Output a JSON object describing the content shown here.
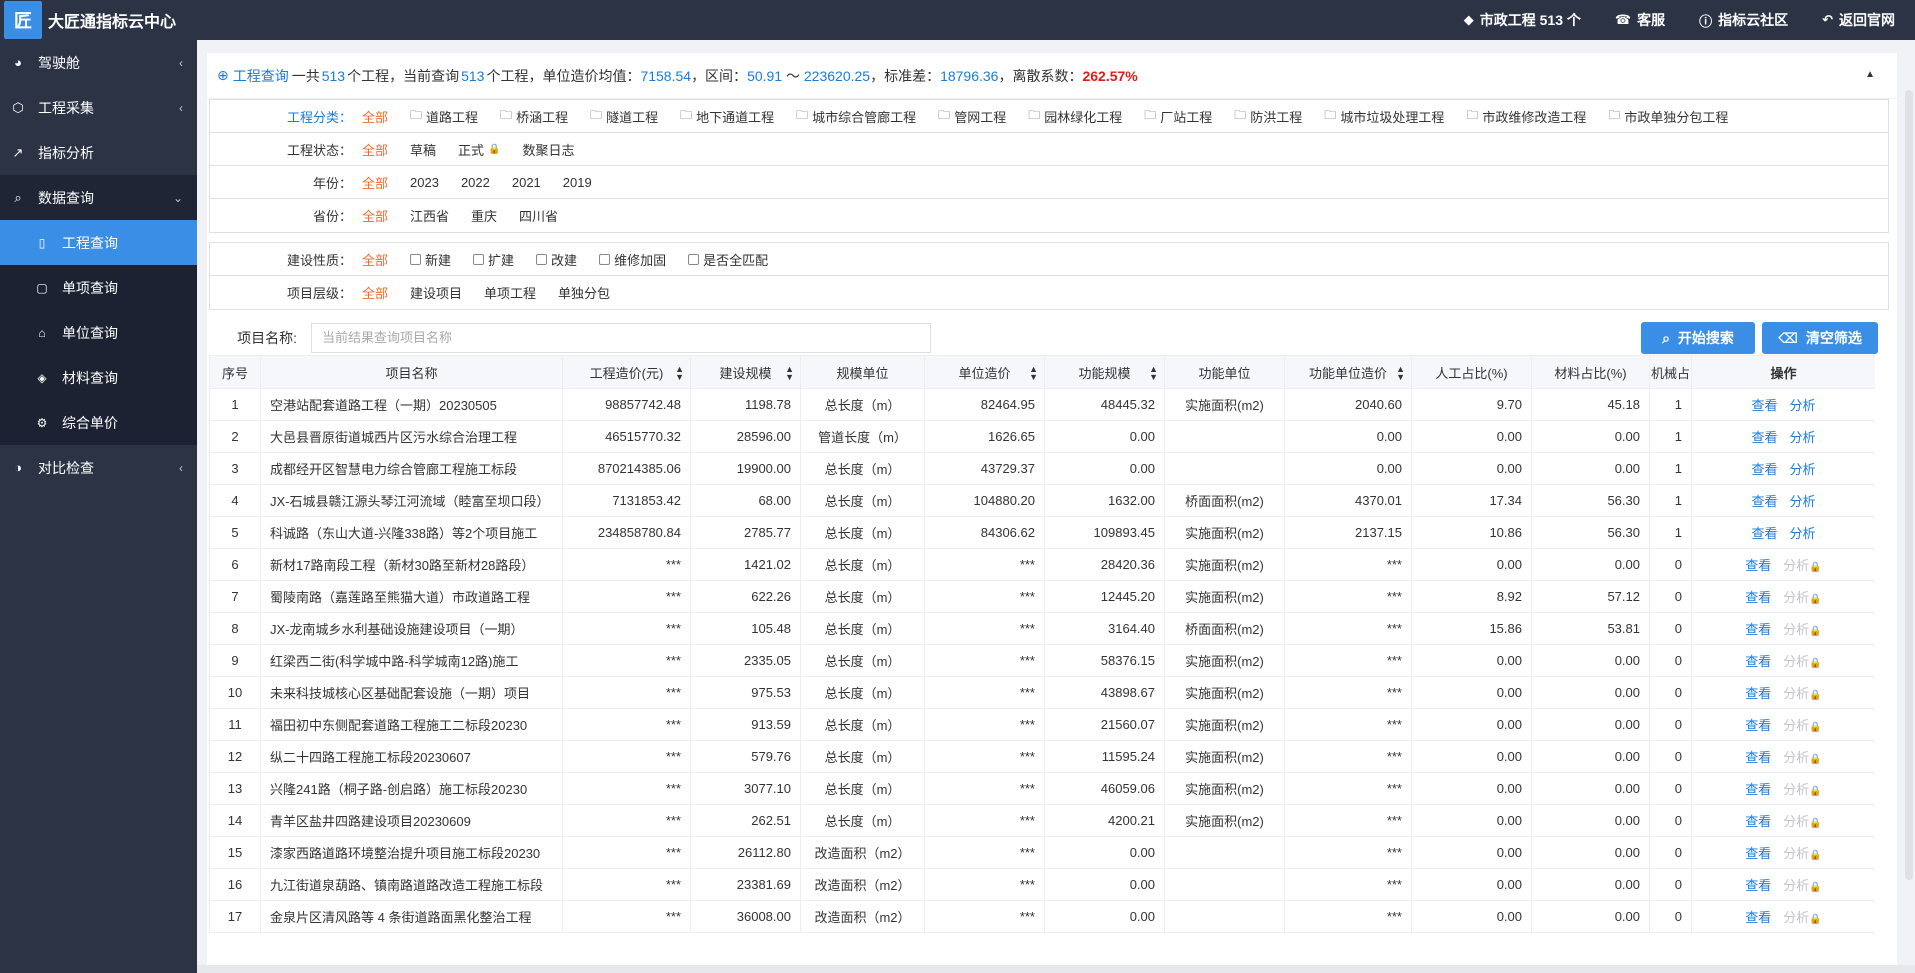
{
  "app": {
    "title": "大匠通指标云中心",
    "logo_text": "匠"
  },
  "topnav": {
    "project_count": "市政工程 513 个",
    "service": "客服",
    "community": "指标云社区",
    "back": "返回官网"
  },
  "sidebar": {
    "items": [
      {
        "label": "驾驶舱",
        "icon": "dashboard-icon"
      },
      {
        "label": "工程采集",
        "icon": "cube-icon"
      },
      {
        "label": "指标分析",
        "icon": "chart-line-icon"
      },
      {
        "label": "数据查询",
        "icon": "search-icon"
      },
      {
        "label": "对比检查",
        "icon": "compare-icon"
      }
    ],
    "subitems": [
      {
        "label": "工程查询"
      },
      {
        "label": "单项查询"
      },
      {
        "label": "单位查询"
      },
      {
        "label": "材料查询"
      },
      {
        "label": "综合单价"
      }
    ]
  },
  "summary": {
    "prefix": "工程查询",
    "t1": "一共",
    "total": "513",
    "t2": "个工程，当前查询",
    "current": "513",
    "t3": "个工程，单位造价均值：",
    "mean": "7158.54",
    "t4": "，区间：",
    "range_low": "50.91",
    "tilde": " ～ ",
    "range_high": "223620.25",
    "t5": "，标准差：",
    "std": "18796.36",
    "t6": "，离散系数：",
    "cv": "262.57%"
  },
  "filters": {
    "category": {
      "label": "工程分类：",
      "options": [
        "全部",
        "道路工程",
        "桥涵工程",
        "隧道工程",
        "地下通道工程",
        "城市综合管廊工程",
        "管网工程",
        "园林绿化工程",
        "厂站工程",
        "防洪工程",
        "城市垃圾处理工程",
        "市政维修改造工程",
        "市政单独分包工程"
      ]
    },
    "status": {
      "label": "工程状态：",
      "options": [
        "全部",
        "草稿",
        "正式",
        "数聚日志"
      ]
    },
    "year": {
      "label": "年份：",
      "options": [
        "全部",
        "2023",
        "2022",
        "2021",
        "2019"
      ]
    },
    "province": {
      "label": "省份：",
      "options": [
        "全部",
        "江西省",
        "重庆",
        "四川省"
      ]
    },
    "nature": {
      "label": "建设性质：",
      "options": [
        "全部",
        "新建",
        "扩建",
        "改建",
        "维修加固",
        "是否全匹配"
      ]
    },
    "level": {
      "label": "项目层级：",
      "options": [
        "全部",
        "建设项目",
        "单项工程",
        "单独分包"
      ]
    }
  },
  "search": {
    "label": "项目名称:",
    "placeholder": "当前结果查询项目名称",
    "search_btn": "开始搜索",
    "clear_btn": "清空筛选"
  },
  "table": {
    "headers": [
      "序号",
      "项目名称",
      "工程造价(元)",
      "建设规模",
      "规模单位",
      "单位造价",
      "功能规模",
      "功能单位",
      "功能单位造价",
      "人工占比(%)",
      "材料占比(%)",
      "机械占",
      "操作"
    ],
    "view": "查看",
    "analyze": "分析",
    "rows": [
      [
        "1",
        "空港站配套道路工程（一期）20230505",
        "98857742.48",
        "1198.78",
        "总长度（m）",
        "82464.95",
        "48445.32",
        "实施面积(m2)",
        "2040.60",
        "9.70",
        "45.18",
        "1"
      ],
      [
        "2",
        "大邑县晋原街道城西片区污水综合治理工程",
        "46515770.32",
        "28596.00",
        "管道长度（m）",
        "1626.65",
        "0.00",
        "",
        "0.00",
        "0.00",
        "0.00",
        "1"
      ],
      [
        "3",
        "成都经开区智慧电力综合管廊工程施工标段",
        "870214385.06",
        "19900.00",
        "总长度（m）",
        "43729.37",
        "0.00",
        "",
        "0.00",
        "0.00",
        "0.00",
        "1"
      ],
      [
        "4",
        "JX-石城县赣江源头琴江河流域（睦富至坝口段）",
        "7131853.42",
        "68.00",
        "总长度（m）",
        "104880.20",
        "1632.00",
        "桥面面积(m2)",
        "4370.01",
        "17.34",
        "56.30",
        "1"
      ],
      [
        "5",
        "科诚路（东山大道-兴隆338路）等2个项目施工",
        "234858780.84",
        "2785.77",
        "总长度（m）",
        "84306.62",
        "109893.45",
        "实施面积(m2)",
        "2137.15",
        "10.86",
        "56.30",
        "1"
      ],
      [
        "6",
        "新材17路南段工程（新材30路至新材28路段）",
        "***",
        "1421.02",
        "总长度（m）",
        "***",
        "28420.36",
        "实施面积(m2)",
        "***",
        "0.00",
        "0.00",
        "0"
      ],
      [
        "7",
        "蜀陵南路（嘉莲路至熊猫大道）市政道路工程",
        "***",
        "622.26",
        "总长度（m）",
        "***",
        "12445.20",
        "实施面积(m2)",
        "***",
        "8.92",
        "57.12",
        "0"
      ],
      [
        "8",
        "JX-龙南城乡水利基础设施建设项目（一期）",
        "***",
        "105.48",
        "总长度（m）",
        "***",
        "3164.40",
        "桥面面积(m2)",
        "***",
        "15.86",
        "53.81",
        "0"
      ],
      [
        "9",
        "红梁西二街(科学城中路-科学城南12路)施工",
        "***",
        "2335.05",
        "总长度（m）",
        "***",
        "58376.15",
        "实施面积(m2)",
        "***",
        "0.00",
        "0.00",
        "0"
      ],
      [
        "10",
        "未来科技城核心区基础配套设施（一期）项目",
        "***",
        "975.53",
        "总长度（m）",
        "***",
        "43898.67",
        "实施面积(m2)",
        "***",
        "0.00",
        "0.00",
        "0"
      ],
      [
        "11",
        "福田初中东侧配套道路工程施工二标段20230",
        "***",
        "913.59",
        "总长度（m）",
        "***",
        "21560.07",
        "实施面积(m2)",
        "***",
        "0.00",
        "0.00",
        "0"
      ],
      [
        "12",
        "纵二十四路工程施工标段20230607",
        "***",
        "579.76",
        "总长度（m）",
        "***",
        "11595.24",
        "实施面积(m2)",
        "***",
        "0.00",
        "0.00",
        "0"
      ],
      [
        "13",
        "兴隆241路（桐子路-创启路）施工标段20230",
        "***",
        "3077.10",
        "总长度（m）",
        "***",
        "46059.06",
        "实施面积(m2)",
        "***",
        "0.00",
        "0.00",
        "0"
      ],
      [
        "14",
        "青羊区盐井四路建设项目20230609",
        "***",
        "262.51",
        "总长度（m）",
        "***",
        "4200.21",
        "实施面积(m2)",
        "***",
        "0.00",
        "0.00",
        "0"
      ],
      [
        "15",
        "漆家西路道路环境整治提升项目施工标段20230",
        "***",
        "26112.80",
        "改造面积（m2）",
        "***",
        "0.00",
        "",
        "***",
        "0.00",
        "0.00",
        "0"
      ],
      [
        "16",
        "九江街道泉葫路、镇南路道路改造工程施工标段",
        "***",
        "23381.69",
        "改造面积（m2）",
        "***",
        "0.00",
        "",
        "***",
        "0.00",
        "0.00",
        "0"
      ],
      [
        "17",
        "金泉片区清风路等 4 条街道路面黑化整治工程",
        "***",
        "36008.00",
        "改造面积（m2）",
        "***",
        "0.00",
        "",
        "***",
        "0.00",
        "0.00",
        "0"
      ]
    ]
  }
}
